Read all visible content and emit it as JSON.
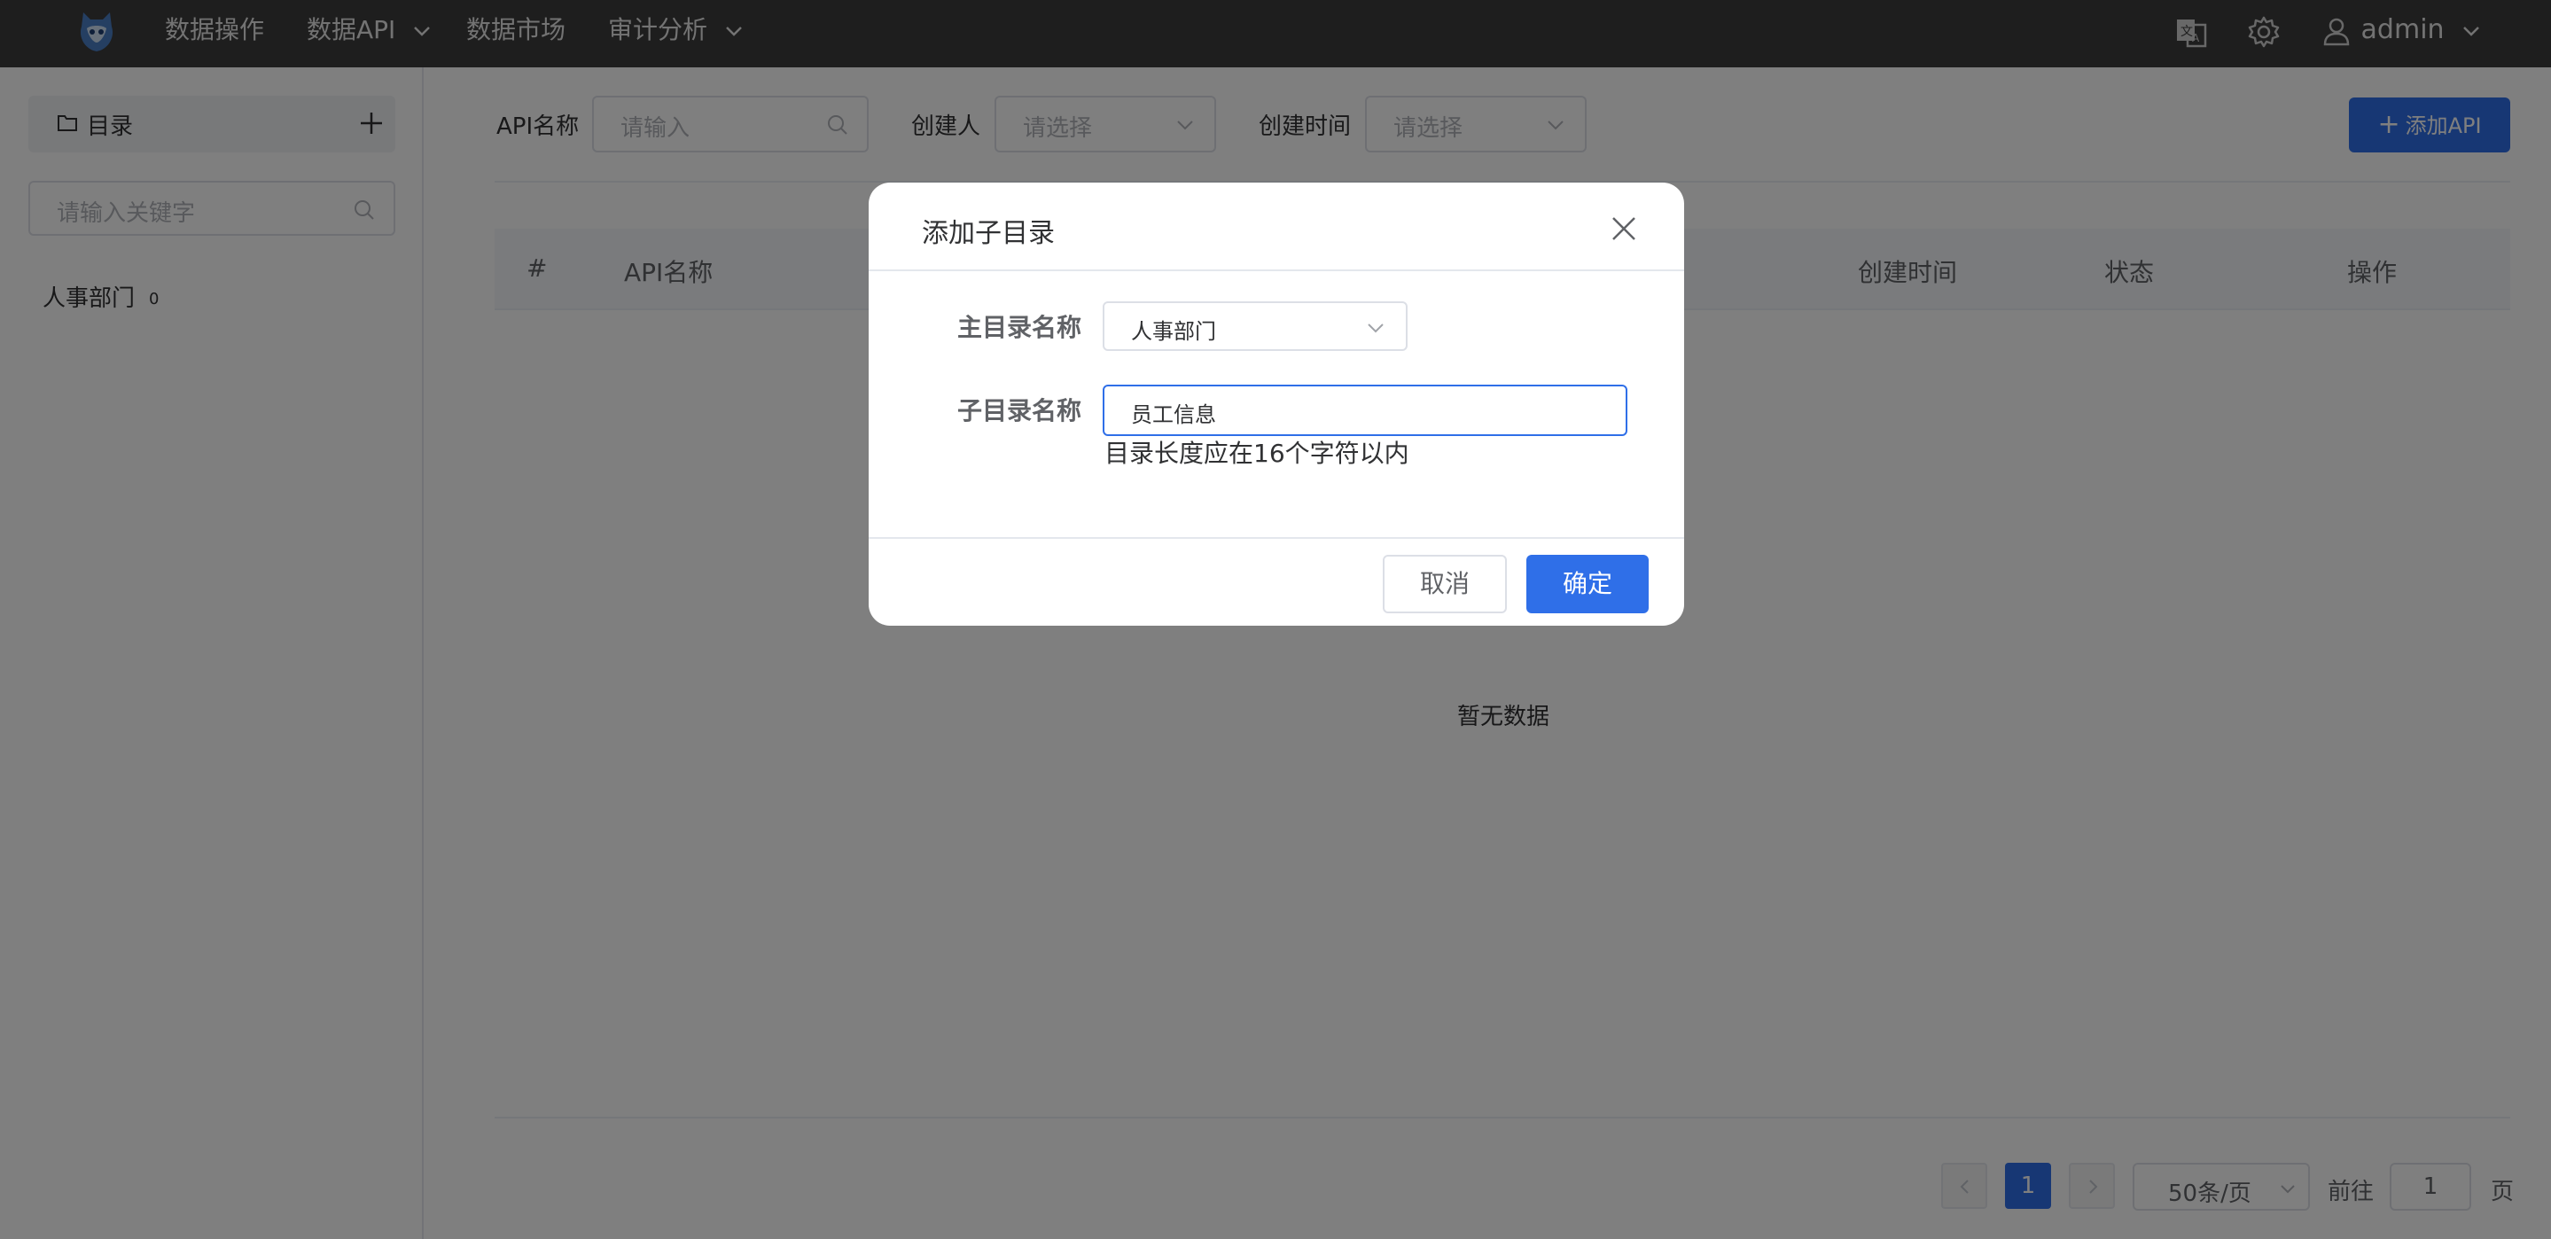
{
  "nav": {
    "items": [
      {
        "label": "数据操作"
      },
      {
        "label": "数据API"
      },
      {
        "label": "数据市场"
      },
      {
        "label": "审计分析"
      }
    ],
    "icons": [
      "translate-icon",
      "gear-icon",
      "user-icon"
    ],
    "user": "admin"
  },
  "sidebar": {
    "header_label": "目录",
    "search_placeholder": "请输入关键字",
    "tree": [
      {
        "label": "人事部门",
        "count": "0"
      }
    ]
  },
  "filters": {
    "api_name_label": "API名称",
    "api_name_placeholder": "请输入",
    "creator_label": "创建人",
    "creator_placeholder": "请选择",
    "created_time_label": "创建时间",
    "created_time_placeholder": "请选择",
    "add_button": "添加API"
  },
  "table": {
    "columns": [
      "#",
      "API名称",
      "创建时间",
      "状态",
      "操作"
    ],
    "empty_text": "暂无数据"
  },
  "pagination": {
    "current_page": "1",
    "page_size": "50条/页",
    "goto_prefix": "前往",
    "goto_value": "1",
    "goto_suffix": "页"
  },
  "dialog": {
    "title": "添加子目录",
    "parent_label": "主目录名称",
    "parent_value": "人事部门",
    "child_label": "子目录名称",
    "child_value": "员工信息",
    "hint": "目录长度应在16个字符以内",
    "cancel": "取消",
    "confirm": "确定"
  },
  "colors": {
    "topbar": "#3c3c3c",
    "primary": "#2f6fe8",
    "overlay": "rgba(0,0,0,0.5)"
  }
}
